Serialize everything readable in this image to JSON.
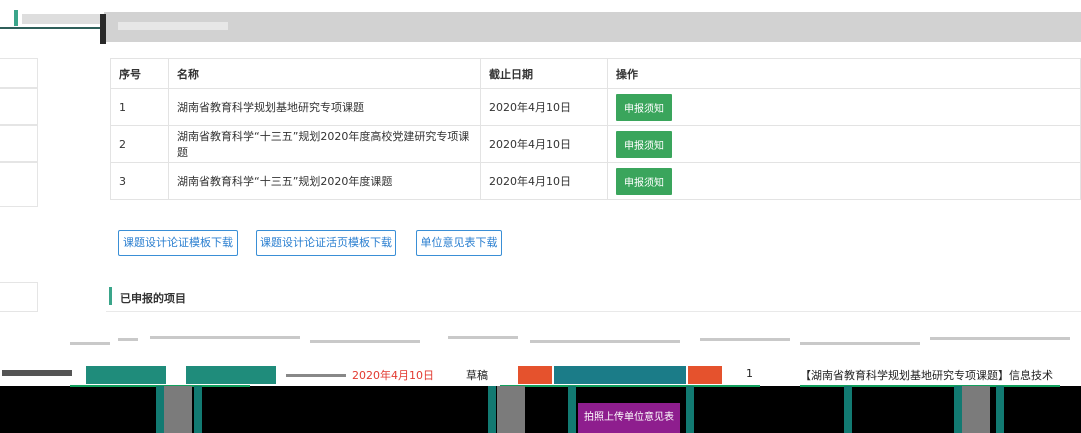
{
  "header": {
    "title": ""
  },
  "deadline_table": {
    "columns": [
      "序号",
      "名称",
      "截止日期",
      "操作"
    ],
    "rows": [
      {
        "index": "1",
        "name": "湖南省教育科学规划基地研究专项课题",
        "deadline": "2020年4月10日",
        "action": "申报须知"
      },
      {
        "index": "2",
        "name": "湖南省教育科学“十三五”规划2020年度高校党建研究专项课题",
        "deadline": "2020年4月10日",
        "action": "申报须知"
      },
      {
        "index": "3",
        "name": "湖南省教育科学“十三五”规划2020年度课题",
        "deadline": "2020年4月10日",
        "action": "申报须知"
      }
    ]
  },
  "downloads": [
    "课题设计论证模板下载",
    "课题设计论证活页模板下载",
    "单位意见表下载"
  ],
  "declared_section": {
    "title": "已申报的项目"
  },
  "declared_row": {
    "deadline": "2020年4月10日",
    "status": "草稿",
    "index": "1",
    "project_name": "【湖南省教育科学规划基地研究专项课题】信息技术",
    "upload_unit_opinion": "拍照上传单位意见表"
  },
  "colors": {
    "accent_green": "#3aa58a",
    "button_green": "#3aa55c",
    "link_blue": "#2b7fd0",
    "purple": "#8e1e8e",
    "warning_orange": "#e5522d"
  }
}
